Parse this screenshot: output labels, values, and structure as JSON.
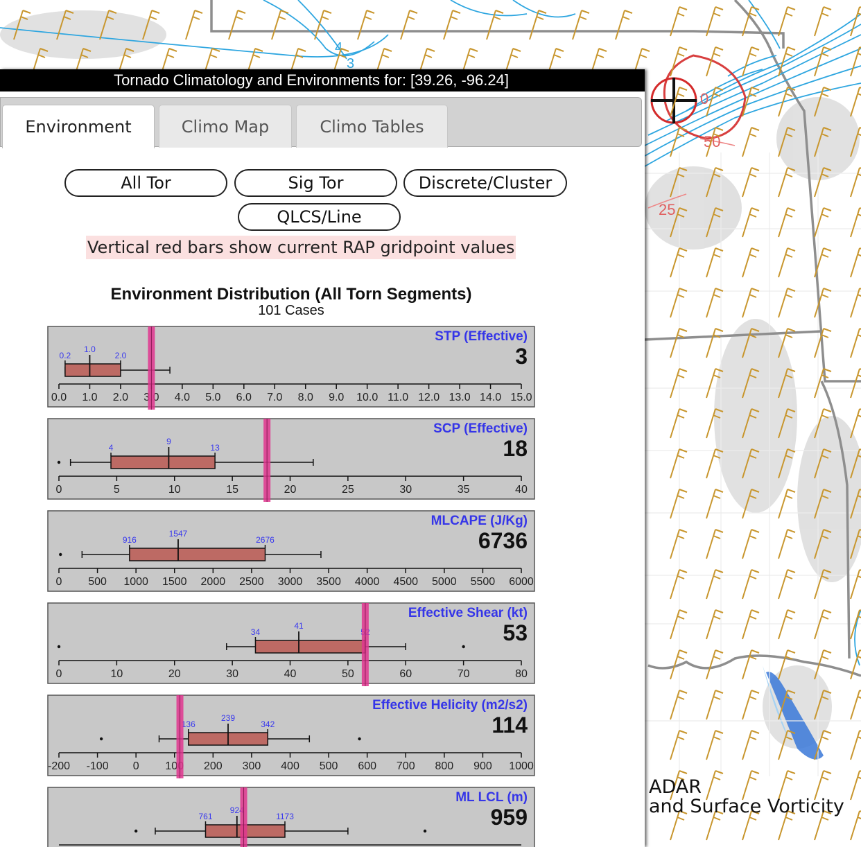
{
  "window": {
    "title": "Tornado Climatology and Environments for: [39.26, -96.24]"
  },
  "tabs": [
    {
      "label": "Environment",
      "active": true
    },
    {
      "label": "Climo Map",
      "active": false
    },
    {
      "label": "Climo Tables",
      "active": false
    }
  ],
  "filters": [
    {
      "label": "All Tor"
    },
    {
      "label": "Sig Tor"
    },
    {
      "label": "Discrete/Cluster"
    },
    {
      "label": "QLCS/Line"
    }
  ],
  "note": "Vertical red bars show current RAP gridpoint values",
  "distribution": {
    "title": "Environment Distribution (All Torn Segments)",
    "cases": "101 Cases"
  },
  "map": {
    "caption_line1": "ADAR",
    "caption_line2": "and Surface Vorticity",
    "contour_labels": [
      "4",
      "3",
      "50",
      "25",
      "0"
    ]
  },
  "colors": {
    "box_fill": "#bd6a64",
    "marker": "#e0368f",
    "param_label": "#3535e8",
    "stat_label": "#3838ee",
    "panel_bg": "#c8c8c8",
    "wind_barb": "#c8962d",
    "contour_blue": "#2ea6e0",
    "contour_red": "#d42a2a"
  },
  "chart_data": [
    {
      "type": "box",
      "label": "STP (Effective)",
      "value": "3",
      "current": 3.0,
      "xlim": [
        0,
        15
      ],
      "ticks": [
        "0.0",
        "1.0",
        "2.0",
        "3.0",
        "4.0",
        "5.0",
        "6.0",
        "7.0",
        "8.0",
        "9.0",
        "10.0",
        "11.0",
        "12.0",
        "13.0",
        "14.0",
        "15.0"
      ],
      "whisker_low": 0.2,
      "q1": 0.2,
      "median": 1.0,
      "q3": 2.0,
      "whisker_high": 3.6,
      "outliers": [],
      "stat_labels": [
        "0.2",
        "1.0",
        "2.0"
      ]
    },
    {
      "type": "box",
      "label": "SCP (Effective)",
      "value": "18",
      "current": 18,
      "xlim": [
        0,
        40
      ],
      "ticks": [
        "0",
        "5",
        "10",
        "15",
        "20",
        "25",
        "30",
        "35",
        "40"
      ],
      "whisker_low": 1,
      "q1": 4.5,
      "median": 9.5,
      "q3": 13.5,
      "whisker_high": 22,
      "outliers": [
        0
      ],
      "stat_labels": [
        "4",
        "9",
        "13"
      ]
    },
    {
      "type": "box",
      "label": "MLCAPE (J/Kg)",
      "value": "6736",
      "current": null,
      "xlim": [
        0,
        6000
      ],
      "ticks": [
        "0",
        "500",
        "1000",
        "1500",
        "2000",
        "2500",
        "3000",
        "3500",
        "4000",
        "4500",
        "5000",
        "5500",
        "6000"
      ],
      "whisker_low": 300,
      "q1": 916,
      "median": 1547,
      "q3": 2676,
      "whisker_high": 3400,
      "outliers": [
        20
      ],
      "stat_labels": [
        "916",
        "1547",
        "2676"
      ]
    },
    {
      "type": "box",
      "label": "Effective Shear (kt)",
      "value": "53",
      "current": 53,
      "xlim": [
        0,
        80
      ],
      "ticks": [
        "0",
        "10",
        "20",
        "30",
        "40",
        "50",
        "60",
        "70",
        "80"
      ],
      "whisker_low": 29,
      "q1": 34,
      "median": 41.5,
      "q3": 53,
      "whisker_high": 60,
      "outliers": [
        0,
        70
      ],
      "stat_labels": [
        "34",
        "41",
        "52"
      ]
    },
    {
      "type": "box",
      "label": "Effective Helicity (m2/s2)",
      "value": "114",
      "current": 114,
      "xlim": [
        -200,
        1000
      ],
      "ticks": [
        "-200",
        "-100",
        "0",
        "100",
        "200",
        "300",
        "400",
        "500",
        "600",
        "700",
        "800",
        "900",
        "1000"
      ],
      "whisker_low": 60,
      "q1": 136,
      "median": 239,
      "q3": 342,
      "whisker_high": 450,
      "outliers": [
        -90,
        580
      ],
      "stat_labels": [
        "136",
        "239",
        "342"
      ]
    },
    {
      "type": "box",
      "label": "ML LCL (m)",
      "value": "959",
      "current": 959,
      "xlim": [
        0,
        2400
      ],
      "ticks": [],
      "whisker_low": 500,
      "q1": 761,
      "median": 924,
      "q3": 1173,
      "whisker_high": 1500,
      "outliers": [
        400,
        1900
      ],
      "stat_labels": [
        "761",
        "924",
        "1173"
      ]
    }
  ]
}
